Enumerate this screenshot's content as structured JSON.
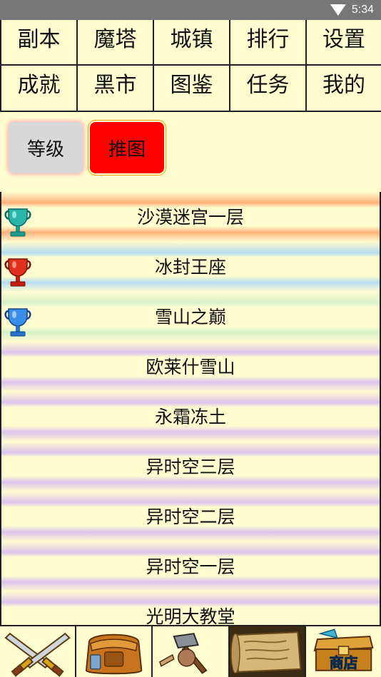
{
  "status_bar": {
    "time": "5:34"
  },
  "menu": {
    "row1": [
      "副本",
      "魔塔",
      "城镇",
      "排行",
      "设置"
    ],
    "row2": [
      "成就",
      "黑市",
      "图鉴",
      "任务",
      "我的"
    ]
  },
  "modes": {
    "level_label": "等级",
    "push_label": "推图"
  },
  "levels": [
    {
      "name": "沙漠迷宫一层",
      "trophy": "teal-trophy-icon",
      "stripe": "#ffb27a"
    },
    {
      "name": "冰封王座",
      "trophy": "red-trophy-icon",
      "stripe": "#b7dcf0"
    },
    {
      "name": "雪山之巅",
      "trophy": "blue-trophy-icon",
      "stripe": "#d6f2c8"
    },
    {
      "name": "欧莱什雪山",
      "trophy": "",
      "stripe": "#dcc3ee"
    },
    {
      "name": "永霜冻土",
      "trophy": "",
      "stripe": "#dcc3ee"
    },
    {
      "name": "异时空三层",
      "trophy": "",
      "stripe": "#dcc3ee"
    },
    {
      "name": "异时空二层",
      "trophy": "",
      "stripe": "#dcc3ee"
    },
    {
      "name": "异时空一层",
      "trophy": "",
      "stripe": "#dcc3ee"
    },
    {
      "name": "光明大教堂",
      "trophy": "",
      "stripe": "#dcc3ee"
    }
  ],
  "bottom_nav": [
    {
      "icon": "crossed-swords-icon"
    },
    {
      "icon": "backpack-icon"
    },
    {
      "icon": "crafting-hammer-icon"
    },
    {
      "icon": "scroll-map-icon"
    },
    {
      "icon": "shop-chest-icon",
      "label": "商店"
    }
  ],
  "colors": {
    "background": "#fffdd0",
    "push_button": "#ff0000",
    "level_button": "#d8d8d8"
  }
}
